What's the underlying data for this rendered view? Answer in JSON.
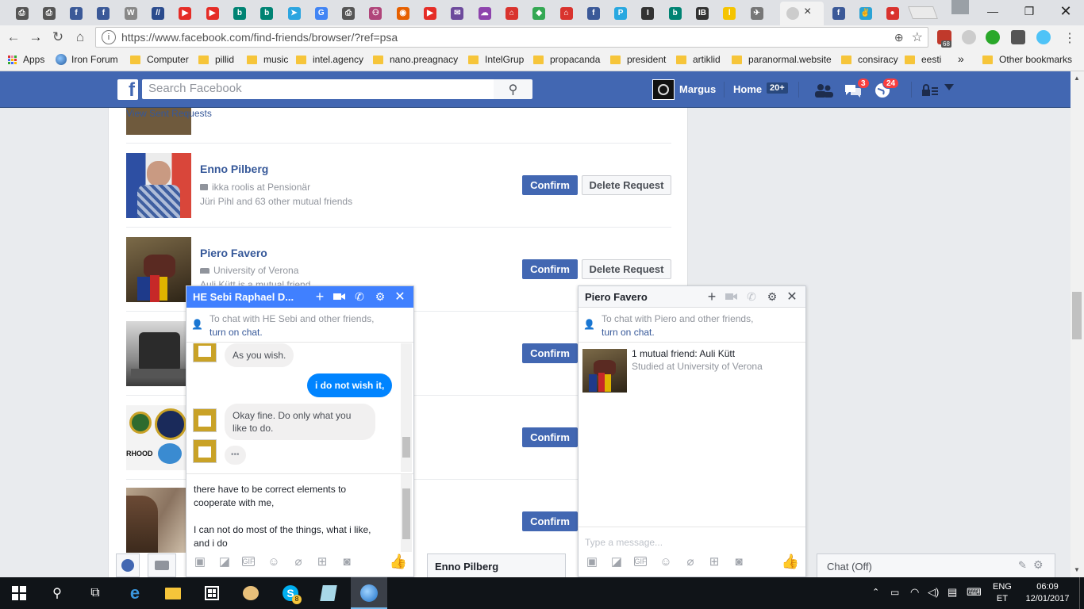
{
  "browser": {
    "url": "https://www.facebook.com/find-friends/browser/?ref=psa",
    "ext_badge": "68",
    "tabs": [
      {
        "icon": "printer-icon",
        "color": "#555"
      },
      {
        "icon": "printer-icon",
        "color": "#555"
      },
      {
        "icon": "facebook-icon",
        "color": "#3b5998"
      },
      {
        "icon": "facebook-icon",
        "color": "#3b5998"
      },
      {
        "icon": "wikipedia-icon",
        "color": "#888"
      },
      {
        "icon": "slashes-icon",
        "color": "#2a4b8d"
      },
      {
        "icon": "youtube-icon",
        "color": "#e52d27"
      },
      {
        "icon": "youtube-icon",
        "color": "#e52d27"
      },
      {
        "icon": "bing-icon",
        "color": "#008373"
      },
      {
        "icon": "bing-icon",
        "color": "#008373"
      },
      {
        "icon": "telegram-icon",
        "color": "#2ca5e0"
      },
      {
        "icon": "google-icon",
        "color": "#4285f4"
      },
      {
        "icon": "printer-icon",
        "color": "#555"
      },
      {
        "icon": "people-icon",
        "color": "#b0457a"
      },
      {
        "icon": "firefox-icon",
        "color": "#e66000"
      },
      {
        "icon": "youtube-icon",
        "color": "#e52d27"
      },
      {
        "icon": "mail-icon",
        "color": "#6d4a9c"
      },
      {
        "icon": "cloud-icon",
        "color": "#8e44ad"
      },
      {
        "icon": "house-icon",
        "color": "#d9332e"
      },
      {
        "icon": "maps-icon",
        "color": "#34a853"
      },
      {
        "icon": "house-icon",
        "color": "#d9332e"
      },
      {
        "icon": "facebook-icon",
        "color": "#3b5998"
      },
      {
        "icon": "pm-icon",
        "color": "#29a8e0"
      },
      {
        "icon": "i-icon",
        "color": "#333"
      },
      {
        "icon": "bing-icon",
        "color": "#008373"
      },
      {
        "icon": "ibt-icon",
        "color": "#333"
      },
      {
        "icon": "l-icon",
        "color": "#f5c400"
      },
      {
        "icon": "bird-icon",
        "color": "#777"
      }
    ],
    "active_tab": {
      "icon": "facebook-icon",
      "close": "×"
    },
    "extra_tabs": [
      {
        "icon": "facebook-icon",
        "color": "#3b5998"
      },
      {
        "icon": "peace-icon",
        "color": "#2aa3d5"
      },
      {
        "icon": "tomato-icon",
        "color": "#d9332e"
      }
    ]
  },
  "bookmarks": {
    "apps": "Apps",
    "items": [
      "Iron Forum",
      "Computer",
      "pillid",
      "music",
      "intel.agency",
      "nano.preagnacy",
      "IntelGrup",
      "propacanda",
      "president",
      "artiklid",
      "paranormal.website",
      "consiracy",
      "eesti"
    ],
    "overflow": "»",
    "other": "Other bookmarks"
  },
  "fb": {
    "search_placeholder": "Search Facebook",
    "profile_name": "Margus",
    "home": "Home",
    "home_badge": "20+",
    "messages_badge": "3",
    "notifications_badge": "24"
  },
  "requests": {
    "view_sent": "View Sent Requests",
    "confirm_label": "Confirm",
    "delete_label": "Delete Request",
    "items": [
      {
        "name": "Enno Pilberg",
        "line1": "ikka roolis at Pensionär",
        "line2": "Jüri Pihl and 63 other mutual friends"
      },
      {
        "name": "Piero Favero",
        "line1": "University of Verona",
        "line2": "Auli Kütt is a mutual friend"
      },
      {
        "name": "",
        "line1": "",
        "line2": ""
      },
      {
        "name": "",
        "line1": "",
        "line2": ""
      },
      {
        "name": "",
        "line1": "",
        "line2": ""
      }
    ],
    "row4_photo_text": "RHOOD"
  },
  "chat1": {
    "title": "HE Sebi Raphael D...",
    "notice": "To chat with HE Sebi and other friends,",
    "turn_on": "turn on chat.",
    "messages": [
      {
        "from": "them",
        "text": "As you wish."
      },
      {
        "from": "me",
        "text": "i do not wish it,"
      },
      {
        "from": "them",
        "text": "Okay fine. Do only what you like to do."
      },
      {
        "from": "them",
        "text": "•••"
      }
    ],
    "draft_line1": "there have to be correct elements to",
    "draft_line2": "cooperate with me,",
    "draft_line3": "I can not do most of the things, what i like,",
    "draft_line4": "and i do "
  },
  "chat2": {
    "title": "Piero Favero",
    "notice": "To chat with Piero and other friends,",
    "turn_on": "turn on chat.",
    "mutual": "1 mutual friend: Auli Kütt",
    "studied": "Studied at University of Verona",
    "placeholder": "Type a message..."
  },
  "minimized_chat": "Enno Pilberg",
  "chat_bar": "Chat (Off)",
  "tray": {
    "lang1": "ENG",
    "lang2": "ET",
    "time": "06:09",
    "date": "12/01/2017",
    "skype_badge": "8"
  },
  "colors": {
    "fb_blue": "#4267b2",
    "link": "#365899",
    "chat_blue": "#0084ff"
  }
}
